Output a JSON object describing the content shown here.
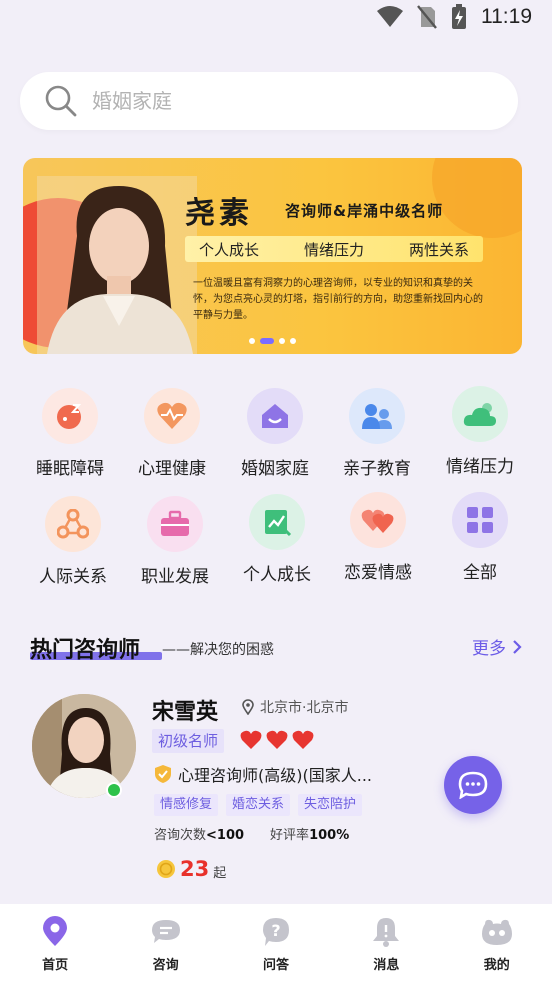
{
  "status_bar": {
    "time": "11:19"
  },
  "search": {
    "placeholder": "婚姻家庭"
  },
  "banner": {
    "name": "尧素",
    "title": "咨询师&岸涌中级名师",
    "tags": [
      "个人成长",
      "情绪压力",
      "两性关系"
    ],
    "description": "一位温暖且富有洞察力的心理咨询师，以专业的知识和真挚的关怀，为您点亮心灵的灯塔，指引前行的方向，助您重新找回内心的平静与力量。",
    "active_dot": 1,
    "dot_count": 4
  },
  "categories": [
    {
      "label": "睡眠障碍",
      "icon": "sleep-icon",
      "bg": "#fde8e3",
      "color": "#f06a4e"
    },
    {
      "label": "心理健康",
      "icon": "heart-pulse-icon",
      "bg": "#fde6dc",
      "color": "#f3975f"
    },
    {
      "label": "婚姻家庭",
      "icon": "home-icon",
      "bg": "#e3dcf8",
      "color": "#8e74e6"
    },
    {
      "label": "亲子教育",
      "icon": "parent-child-icon",
      "bg": "#dde8fb",
      "color": "#4a88ea"
    },
    {
      "label": "情绪压力",
      "icon": "cloud-icon",
      "bg": "#dcf2e6",
      "color": "#3fbf7b"
    },
    {
      "label": "人际关系",
      "icon": "network-icon",
      "bg": "#fde5d8",
      "color": "#f3945c"
    },
    {
      "label": "职业发展",
      "icon": "briefcase-icon",
      "bg": "#f9dff0",
      "color": "#e66aab"
    },
    {
      "label": "个人成长",
      "icon": "growth-chart-icon",
      "bg": "#dcf2e6",
      "color": "#3fbf7b"
    },
    {
      "label": "恋爱情感",
      "icon": "hearts-icon",
      "bg": "#fde3dd",
      "color": "#f0644f"
    },
    {
      "label": "全部",
      "icon": "grid-icon",
      "bg": "#e3dcf8",
      "color": "#8e74e6"
    }
  ],
  "section": {
    "title": "热门咨询师",
    "subtitle": "——解决您的困惑",
    "more_label": "更多"
  },
  "consultant": {
    "name": "宋雪英",
    "location": "北京市·北京市",
    "level": "初级名师",
    "hearts": 3,
    "certification": "心理咨询师(高级)(国家人...",
    "tags": [
      "情感修复",
      "婚恋关系",
      "失恋陪护"
    ],
    "consult_label": "咨询次数",
    "consult_value": "<100",
    "rating_label": "好评率",
    "rating_value": "100%",
    "price": "23",
    "price_unit": "起"
  },
  "bottom_nav": [
    {
      "label": "首页",
      "icon": "home-pin-icon",
      "active": true
    },
    {
      "label": "咨询",
      "icon": "chat-bubble-icon",
      "active": false
    },
    {
      "label": "问答",
      "icon": "question-icon",
      "active": false
    },
    {
      "label": "消息",
      "icon": "bell-icon",
      "active": false
    },
    {
      "label": "我的",
      "icon": "profile-face-icon",
      "active": false
    }
  ],
  "colors": {
    "accent": "#7662e8",
    "price": "#e8312b",
    "background": "#f2eff8"
  }
}
